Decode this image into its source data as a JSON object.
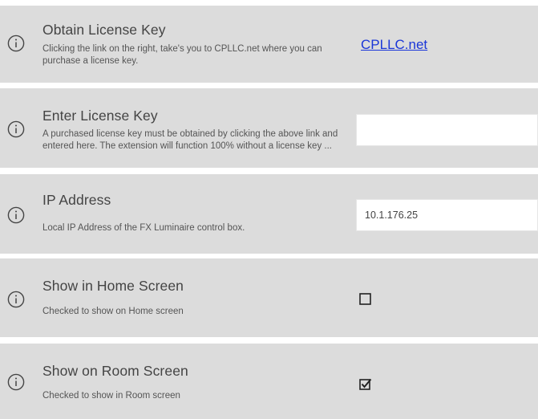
{
  "settings": [
    {
      "title": "Obtain License Key",
      "description_line1": "Clicking the link on the right, take's you to CPLLC.net where you can",
      "description_line2": "purchase a license key.",
      "link_text": "CPLLC.net"
    },
    {
      "title": "Enter License Key",
      "description_line1": "A purchased license key must be obtained by clicking the above link and",
      "description_line2": "entered here. The extension will function 100% without a license key ...",
      "input_value": ""
    },
    {
      "title": "IP Address",
      "description_line1": "Local IP Address of the FX Luminaire control box.",
      "input_value": "10.1.176.25"
    },
    {
      "title": "Show in Home Screen",
      "description_line1": "Checked to show on Home screen",
      "checked": false
    },
    {
      "title": "Show on Room Screen",
      "description_line1": "Checked to show in Room screen",
      "checked": true
    }
  ],
  "icons": {
    "info": "info-circle-icon",
    "checkbox_unchecked": "checkbox-unchecked-icon",
    "checkbox_checked": "checkbox-checked-icon"
  },
  "colors": {
    "row_background": "#dcdcdc",
    "link": "#1a36d8",
    "text": "#444444"
  }
}
